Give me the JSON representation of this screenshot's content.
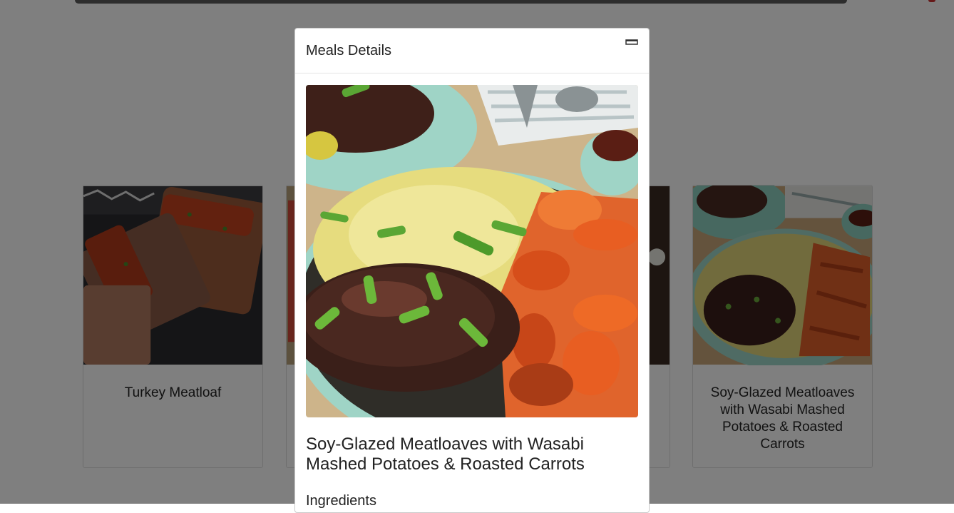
{
  "cards": [
    {
      "title": "Turkey Meatloaf"
    },
    {
      "title": ""
    },
    {
      "title": ""
    },
    {
      "title": "Soy-Glazed Meatloaves with Wasabi Mashed Potatoes & Roasted Carrots"
    }
  ],
  "modal": {
    "title": "Meals Details",
    "meal_name": "Soy-Glazed Meatloaves with Wasabi Mashed Potatoes & Roasted Carrots",
    "ingredients_heading": "Ingredients"
  },
  "icons": {
    "close": "close-icon"
  },
  "colors": {
    "overlay": "rgba(0,0,0,0.5)",
    "modal_bg": "#ffffff",
    "text": "#222222"
  }
}
